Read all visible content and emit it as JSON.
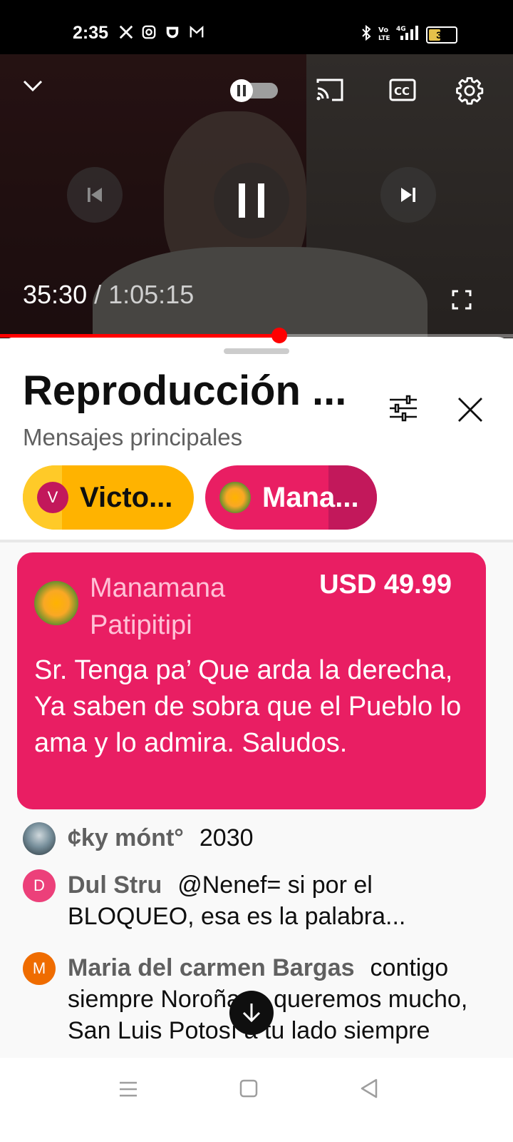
{
  "status_bar": {
    "time": "2:35",
    "battery_level": "39",
    "left_icons": [
      "x-icon",
      "instagram-icon",
      "shield-icon",
      "gmail-icon"
    ],
    "right_icons": [
      "bluetooth-icon",
      "volte-icon",
      "4g-signal-icon",
      "battery-icon"
    ]
  },
  "player": {
    "current_time": "35:30",
    "separator": " / ",
    "duration": "1:05:15",
    "progress": 0.545,
    "state": "playing",
    "autoplay_toggle": "paused"
  },
  "panel": {
    "title": "Reproducción ...",
    "subtitle": "Mensajes principales",
    "chips": [
      {
        "avatar_letter": "V",
        "label": "Victo...",
        "color": "#ffb300"
      },
      {
        "avatar_letter": "",
        "label": "Mana...",
        "color": "#e91e63"
      }
    ]
  },
  "superchat": {
    "author": "Manamana Patipitipi",
    "amount": "USD 49.99",
    "message": "Sr. Tenga pa’ Que arda la derecha, Ya saben de sobra que el Pueblo lo ama y lo admira. Saludos.",
    "color": "#e91e63"
  },
  "messages": [
    {
      "author": "¢ky mónt°",
      "text": "2030",
      "avatar_letter": "",
      "avatar_color": "#607d8b"
    },
    {
      "author": "Dul Stru",
      "text": "@Nenef= si por el BLOQUEO, esa es la palabra...",
      "avatar_letter": "D",
      "avatar_color": "#ec407a"
    },
    {
      "author": "Maria del carmen Bargas",
      "text": "contigo siempre Noroña te queremos mucho, San Luis Potosí a tu lado siempre",
      "avatar_letter": "M",
      "avatar_color": "#ef6c00"
    }
  ],
  "colors": {
    "accent_red": "#ff0000",
    "text_primary": "#0f0f0f",
    "text_secondary": "#606060"
  }
}
